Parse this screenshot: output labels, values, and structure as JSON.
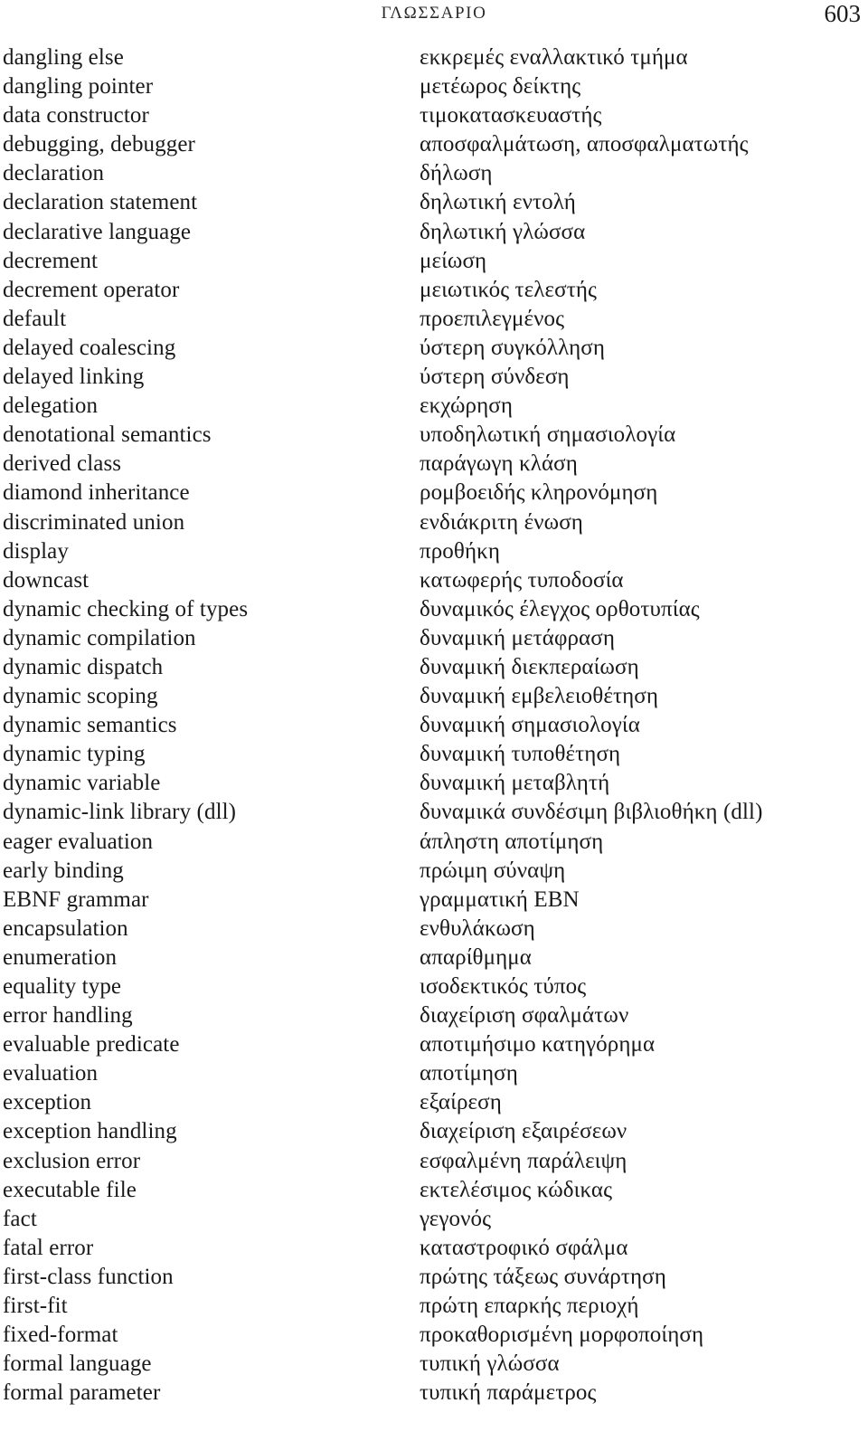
{
  "header": {
    "running_head": "ΓΛΩΣΣΑΡΙΟ",
    "page_number": "603"
  },
  "glossary": {
    "columns": [
      "term_en",
      "term_el"
    ],
    "entries": [
      {
        "term_en": "dangling else",
        "term_el": "εκκρεμές εναλλακτικό τμήμα"
      },
      {
        "term_en": "dangling pointer",
        "term_el": "μετέωρος δείκτης"
      },
      {
        "term_en": "data constructor",
        "term_el": "τιμοκατασκευαστής"
      },
      {
        "term_en": "debugging, debugger",
        "term_el": "αποσφαλμάτωση, αποσφαλματωτής"
      },
      {
        "term_en": "declaration",
        "term_el": "δήλωση"
      },
      {
        "term_en": "declaration statement",
        "term_el": "δηλωτική εντολή"
      },
      {
        "term_en": "declarative language",
        "term_el": "δηλωτική γλώσσα"
      },
      {
        "term_en": "decrement",
        "term_el": "μείωση"
      },
      {
        "term_en": "decrement operator",
        "term_el": "μειωτικός τελεστής"
      },
      {
        "term_en": "default",
        "term_el": "προεπιλεγμένος"
      },
      {
        "term_en": "delayed coalescing",
        "term_el": "ύστερη συγκόλληση"
      },
      {
        "term_en": "delayed linking",
        "term_el": "ύστερη σύνδεση"
      },
      {
        "term_en": "delegation",
        "term_el": "εκχώρηση"
      },
      {
        "term_en": "denotational semantics",
        "term_el": "υποδηλωτική σημασιολογία"
      },
      {
        "term_en": "derived class",
        "term_el": "παράγωγη κλάση"
      },
      {
        "term_en": "diamond inheritance",
        "term_el": "ρομβοειδής κληρονόμηση"
      },
      {
        "term_en": "discriminated union",
        "term_el": "ενδιάκριτη ένωση"
      },
      {
        "term_en": "display",
        "term_el": "προθήκη"
      },
      {
        "term_en": "downcast",
        "term_el": "κατωφερής τυποδοσία"
      },
      {
        "term_en": "dynamic checking of types",
        "term_el": "δυναμικός έλεγχος ορθοτυπίας"
      },
      {
        "term_en": "dynamic compilation",
        "term_el": "δυναμική μετάφραση"
      },
      {
        "term_en": "dynamic dispatch",
        "term_el": "δυναμική διεκπεραίωση"
      },
      {
        "term_en": "dynamic scoping",
        "term_el": "δυναμική εμβελειοθέτηση"
      },
      {
        "term_en": "dynamic semantics",
        "term_el": "δυναμική σημασιολογία"
      },
      {
        "term_en": "dynamic typing",
        "term_el": "δυναμική τυποθέτηση"
      },
      {
        "term_en": "dynamic variable",
        "term_el": "δυναμική μεταβλητή"
      },
      {
        "term_en": "dynamic-link library (dll)",
        "term_el": "δυναμικά συνδέσιμη βιβλιοθήκη (dll)"
      },
      {
        "term_en": "eager evaluation",
        "term_el": "άπληστη αποτίμηση"
      },
      {
        "term_en": "early binding",
        "term_el": "πρώιμη σύναψη"
      },
      {
        "term_en": "EBNF grammar",
        "term_el": "γραμματική EBN"
      },
      {
        "term_en": "encapsulation",
        "term_el": "ενθυλάκωση"
      },
      {
        "term_en": "enumeration",
        "term_el": "απαρίθμημα"
      },
      {
        "term_en": "equality type",
        "term_el": "ισοδεκτικός τύπος"
      },
      {
        "term_en": "error handling",
        "term_el": "διαχείριση σφαλμάτων"
      },
      {
        "term_en": "evaluable predicate",
        "term_el": "αποτιμήσιμο κατηγόρημα"
      },
      {
        "term_en": "evaluation",
        "term_el": "αποτίμηση"
      },
      {
        "term_en": "exception",
        "term_el": "εξαίρεση"
      },
      {
        "term_en": "exception handling",
        "term_el": "διαχείριση εξαιρέσεων"
      },
      {
        "term_en": "exclusion error",
        "term_el": "εσφαλμένη παράλειψη"
      },
      {
        "term_en": "executable file",
        "term_el": "εκτελέσιμος κώδικας"
      },
      {
        "term_en": "fact",
        "term_el": "γεγονός"
      },
      {
        "term_en": "fatal error",
        "term_el": "καταστροφικό σφάλμα"
      },
      {
        "term_en": "first-class function",
        "term_el": "πρώτης τάξεως συνάρτηση"
      },
      {
        "term_en": "first-fit",
        "term_el": "πρώτη επαρκής περιοχή"
      },
      {
        "term_en": "fixed-format",
        "term_el": "προκαθορισμένη μορφοποίηση"
      },
      {
        "term_en": "formal language",
        "term_el": "τυπική γλώσσα"
      },
      {
        "term_en": "formal parameter",
        "term_el": "τυπική παράμετρος"
      }
    ]
  }
}
